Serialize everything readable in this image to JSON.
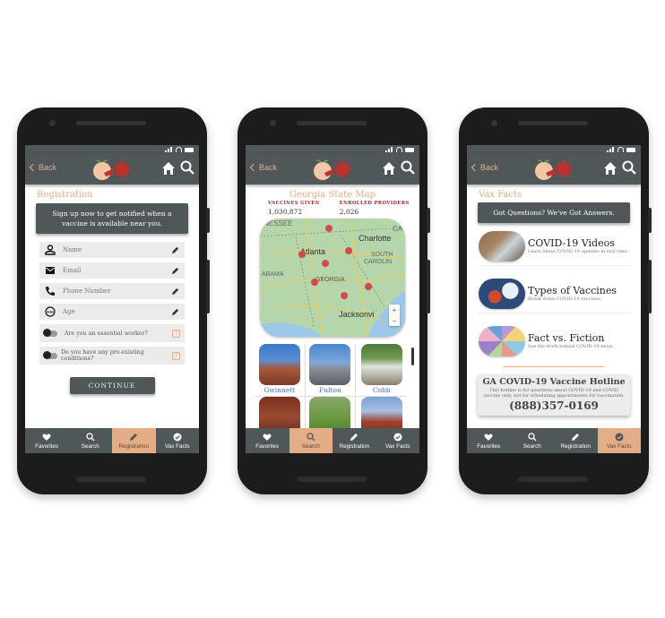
{
  "colors": {
    "appbar": "#4f5759",
    "accent": "#e3ad86",
    "link": "#3b6fd4",
    "stat_label": "#9a2a2a"
  },
  "common": {
    "back_label": "Back",
    "tabs": [
      {
        "label": "Favorites",
        "icon": "heart-icon"
      },
      {
        "label": "Search",
        "icon": "search-icon"
      },
      {
        "label": "Registration",
        "icon": "pencil-icon"
      },
      {
        "label": "Vax Facts",
        "icon": "check-circle-icon"
      }
    ]
  },
  "registration": {
    "title": "Registration",
    "banner": "Sign up now to get notified when a vaccine is available near you.",
    "fields": [
      {
        "placeholder": "Name",
        "icon": "person-icon"
      },
      {
        "placeholder": "Email",
        "icon": "mail-icon"
      },
      {
        "placeholder": "Phone Number",
        "icon": "phone-icon"
      },
      {
        "placeholder": "Age",
        "icon": "age-icon"
      }
    ],
    "toggles": [
      {
        "label": "Are you an essential worker?",
        "on": false
      },
      {
        "label": "Do you have any pre-existing conditions?",
        "on": false
      }
    ],
    "help_symbol": "?",
    "continue_label": "CONTINUE",
    "active_tab": "Registration"
  },
  "map_screen": {
    "title": "Georgia State Map",
    "stats": [
      {
        "label": "VACCINES GIVEN",
        "value": "1,030,872"
      },
      {
        "label": "ENROLLED PROVIDERS",
        "value": "2,026"
      }
    ],
    "map_labels": [
      "NESSEE",
      "Charlotte",
      "CA",
      "Atlanta",
      "SOUTH",
      "CAROLIN",
      "ABAMA",
      "GEORGIA",
      "Jacksonvi"
    ],
    "zoom_in": "+",
    "zoom_out": "−",
    "counties": [
      {
        "name": "Gwinnett"
      },
      {
        "name": "Fulton"
      },
      {
        "name": "Cobb"
      },
      {
        "name": ""
      },
      {
        "name": ""
      },
      {
        "name": ""
      }
    ],
    "active_tab": "Search"
  },
  "facts": {
    "title": "Vax Facts",
    "banner": "Got Questions? We've Got Answers.",
    "items": [
      {
        "title": "COVID-19 Videos",
        "subtitle": "Learn about COVID-19 updates in real time."
      },
      {
        "title": "Types of Vaccines",
        "subtitle": "Break down COVID-19 vaccines."
      },
      {
        "title": "Fact vs. Fiction",
        "subtitle": "See the truth behind COVID-19 news."
      }
    ],
    "hotline": {
      "title": "GA COVID-19 Vaccine Hotline",
      "description": "This hotline is for questions about COVID-19 and COVID vaccine only, not for scheduling appointments for vaccination.",
      "phone": "(888)357-0169"
    },
    "active_tab": "Vax Facts"
  }
}
